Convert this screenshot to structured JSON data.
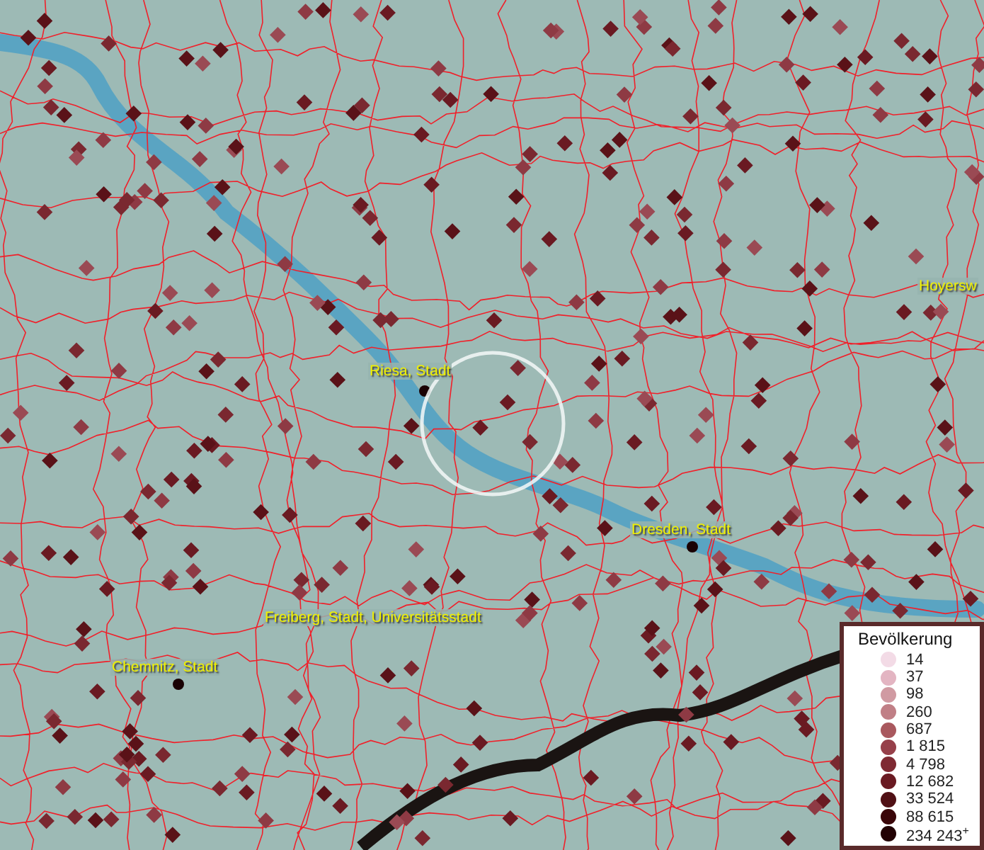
{
  "map": {
    "place_labels": [
      {
        "text": "Hoyersw"
      },
      {
        "text": "Riesa, Stadt"
      },
      {
        "text": "Dresden, Stadt"
      },
      {
        "text": "Freiberg, Stadt, Universitätsstadt"
      },
      {
        "text": "Chemnitz, Stadt"
      }
    ]
  },
  "legend": {
    "title": "Bevölkerung",
    "classes": [
      {
        "label": "14",
        "color": "#f3dbe6"
      },
      {
        "label": "37",
        "color": "#e3b5c2"
      },
      {
        "label": "98",
        "color": "#d09aa2"
      },
      {
        "label": "260",
        "color": "#c07f86"
      },
      {
        "label": "687",
        "color": "#a9585e"
      },
      {
        "label": "1 815",
        "color": "#96404a"
      },
      {
        "label": "4 798",
        "color": "#7f2a33"
      },
      {
        "label": "12 682",
        "color": "#6a1a22"
      },
      {
        "label": "33 524",
        "color": "#501015"
      },
      {
        "label": "88 615",
        "color": "#3a0609"
      },
      {
        "label": "234 243$^{+}$",
        "color": "#220204"
      }
    ]
  }
}
